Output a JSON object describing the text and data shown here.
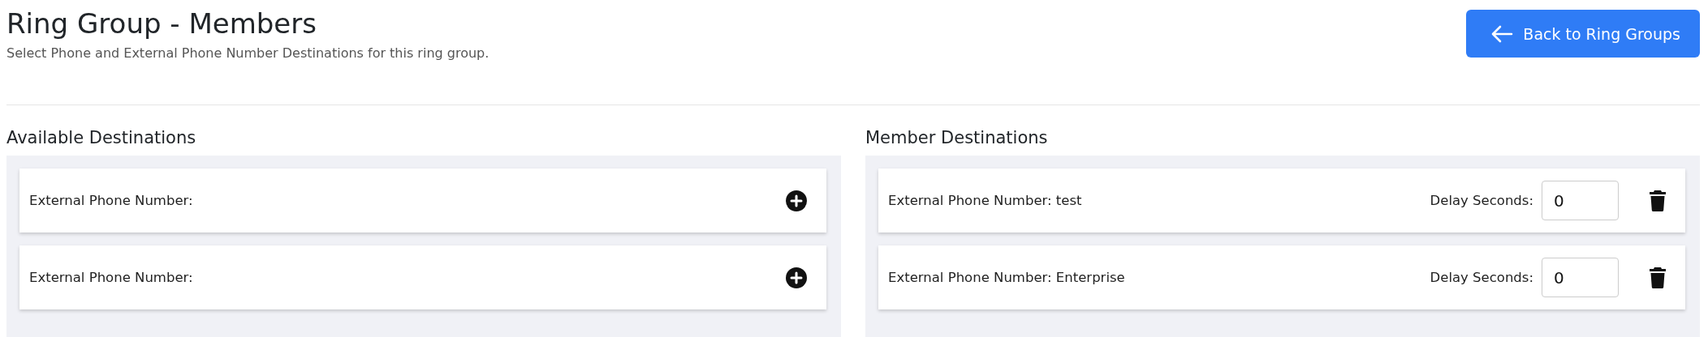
{
  "header": {
    "title": "Ring Group - Members",
    "subtitle": "Select Phone and External Phone Number Destinations for this ring group.",
    "back_button": "Back to Ring Groups"
  },
  "available": {
    "heading": "Available Destinations",
    "items": [
      {
        "label": "External Phone Number:"
      },
      {
        "label": "External Phone Number:"
      }
    ]
  },
  "members": {
    "heading": "Member Destinations",
    "items": [
      {
        "label": "External Phone Number: test",
        "delay_label": "Delay Seconds:",
        "delay_value": "0"
      },
      {
        "label": "External Phone Number: Enterprise",
        "delay_label": "Delay Seconds:",
        "delay_value": "0"
      }
    ]
  }
}
